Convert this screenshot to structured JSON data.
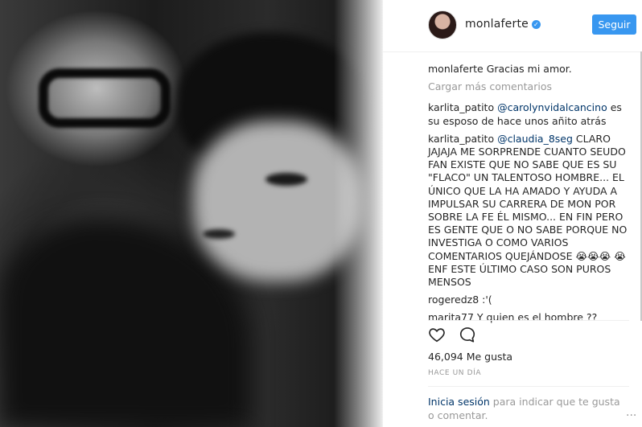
{
  "header": {
    "username": "monlaferte",
    "follow_label": "Seguir"
  },
  "caption": {
    "user": "monlaferte",
    "text": "Gracias mi amor."
  },
  "load_more": "Cargar más comentarios",
  "comments": [
    {
      "user": "karlita_patito",
      "mention": "@carolynvidalcancino",
      "text": " es su esposo de hace unos añito atrás"
    },
    {
      "user": "karlita_patito",
      "mention": "@claudia_8seg",
      "text": " CLARO JAJAJA ME SORPRENDE CUANTO SEUDO FAN EXISTE QUE NO SABE QUE ES SU \"FLACO\" UN TALENTOSO HOMBRE... EL ÚNICO QUE LA HA AMADO Y AYUDA A IMPULSAR SU CARRERA DE MON POR SOBRE LA FE ÉL MISMO... EN FIN PERO ES GENTE QUE O NO SABE PORQUE NO INVESTIGA O COMO VARIOS COMENTARIOS QUEJÁNDOSE 😭😭😭 😭 ENF ESTE ÚLTIMO CASO SON PUROS MENSOS"
    },
    {
      "user": "rogeredz8",
      "mention": "",
      "text": " :'("
    },
    {
      "user": "marita77",
      "mention": "",
      "text": " Y quien es el hombre ??"
    }
  ],
  "likes": "46,094 Me gusta",
  "time": "HACE UN DÍA",
  "login": {
    "link": "Inicia sesión",
    "text": " para indicar que te gusta o comentar."
  },
  "more_dots": "...",
  "icons": {
    "like": "heart-icon",
    "comment": "comment-icon",
    "verified": "verified-badge-icon"
  },
  "colors": {
    "accent": "#3897f0",
    "link": "#003569",
    "muted": "#999999",
    "text": "#262626"
  }
}
